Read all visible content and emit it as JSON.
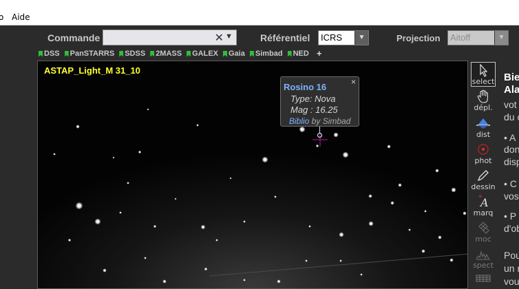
{
  "menu": {
    "items": [
      "o",
      "Aide"
    ]
  },
  "command_bar": {
    "command_label": "Commande",
    "command_value": "",
    "frame_label": "Référentiel",
    "frame_value": "ICRS",
    "projection_label": "Projection",
    "projection_value": "Aitoff"
  },
  "surveys": [
    "DSS",
    "PanSTARRS",
    "SDSS",
    "2MASS",
    "GALEX",
    "Gaia",
    "Simbad",
    "NED"
  ],
  "surveys_add": "+",
  "view": {
    "title": "ASTAP_Light_M 31_10"
  },
  "popup": {
    "title": "Rosino 16",
    "close": "×",
    "type_line": "Type: Nova",
    "mag_line": "Mag : 16.25",
    "biblio_link": "Biblio",
    "biblio_by": "by Simbad"
  },
  "tools": [
    {
      "label": "select",
      "icon": "cursor-icon",
      "selected": true
    },
    {
      "label": "dépl.",
      "icon": "hand-icon"
    },
    {
      "label": "dist",
      "icon": "distance-icon"
    },
    {
      "label": "phot",
      "icon": "photometry-icon"
    },
    {
      "label": "dessin",
      "icon": "pencil-icon"
    },
    {
      "label": "marq",
      "icon": "marker-icon"
    },
    {
      "label": "moc",
      "icon": "moc-icon",
      "disabled": true
    },
    {
      "label": "spect",
      "icon": "spectrum-icon",
      "disabled": true
    }
  ],
  "right_panel": {
    "lines": [
      "Bie",
      "Ala",
      "vot",
      "du c",
      "• A",
      "don",
      "disp",
      "• C",
      "vos",
      "• P",
      "d'ob",
      "Pou",
      "un n",
      "vou"
    ]
  }
}
